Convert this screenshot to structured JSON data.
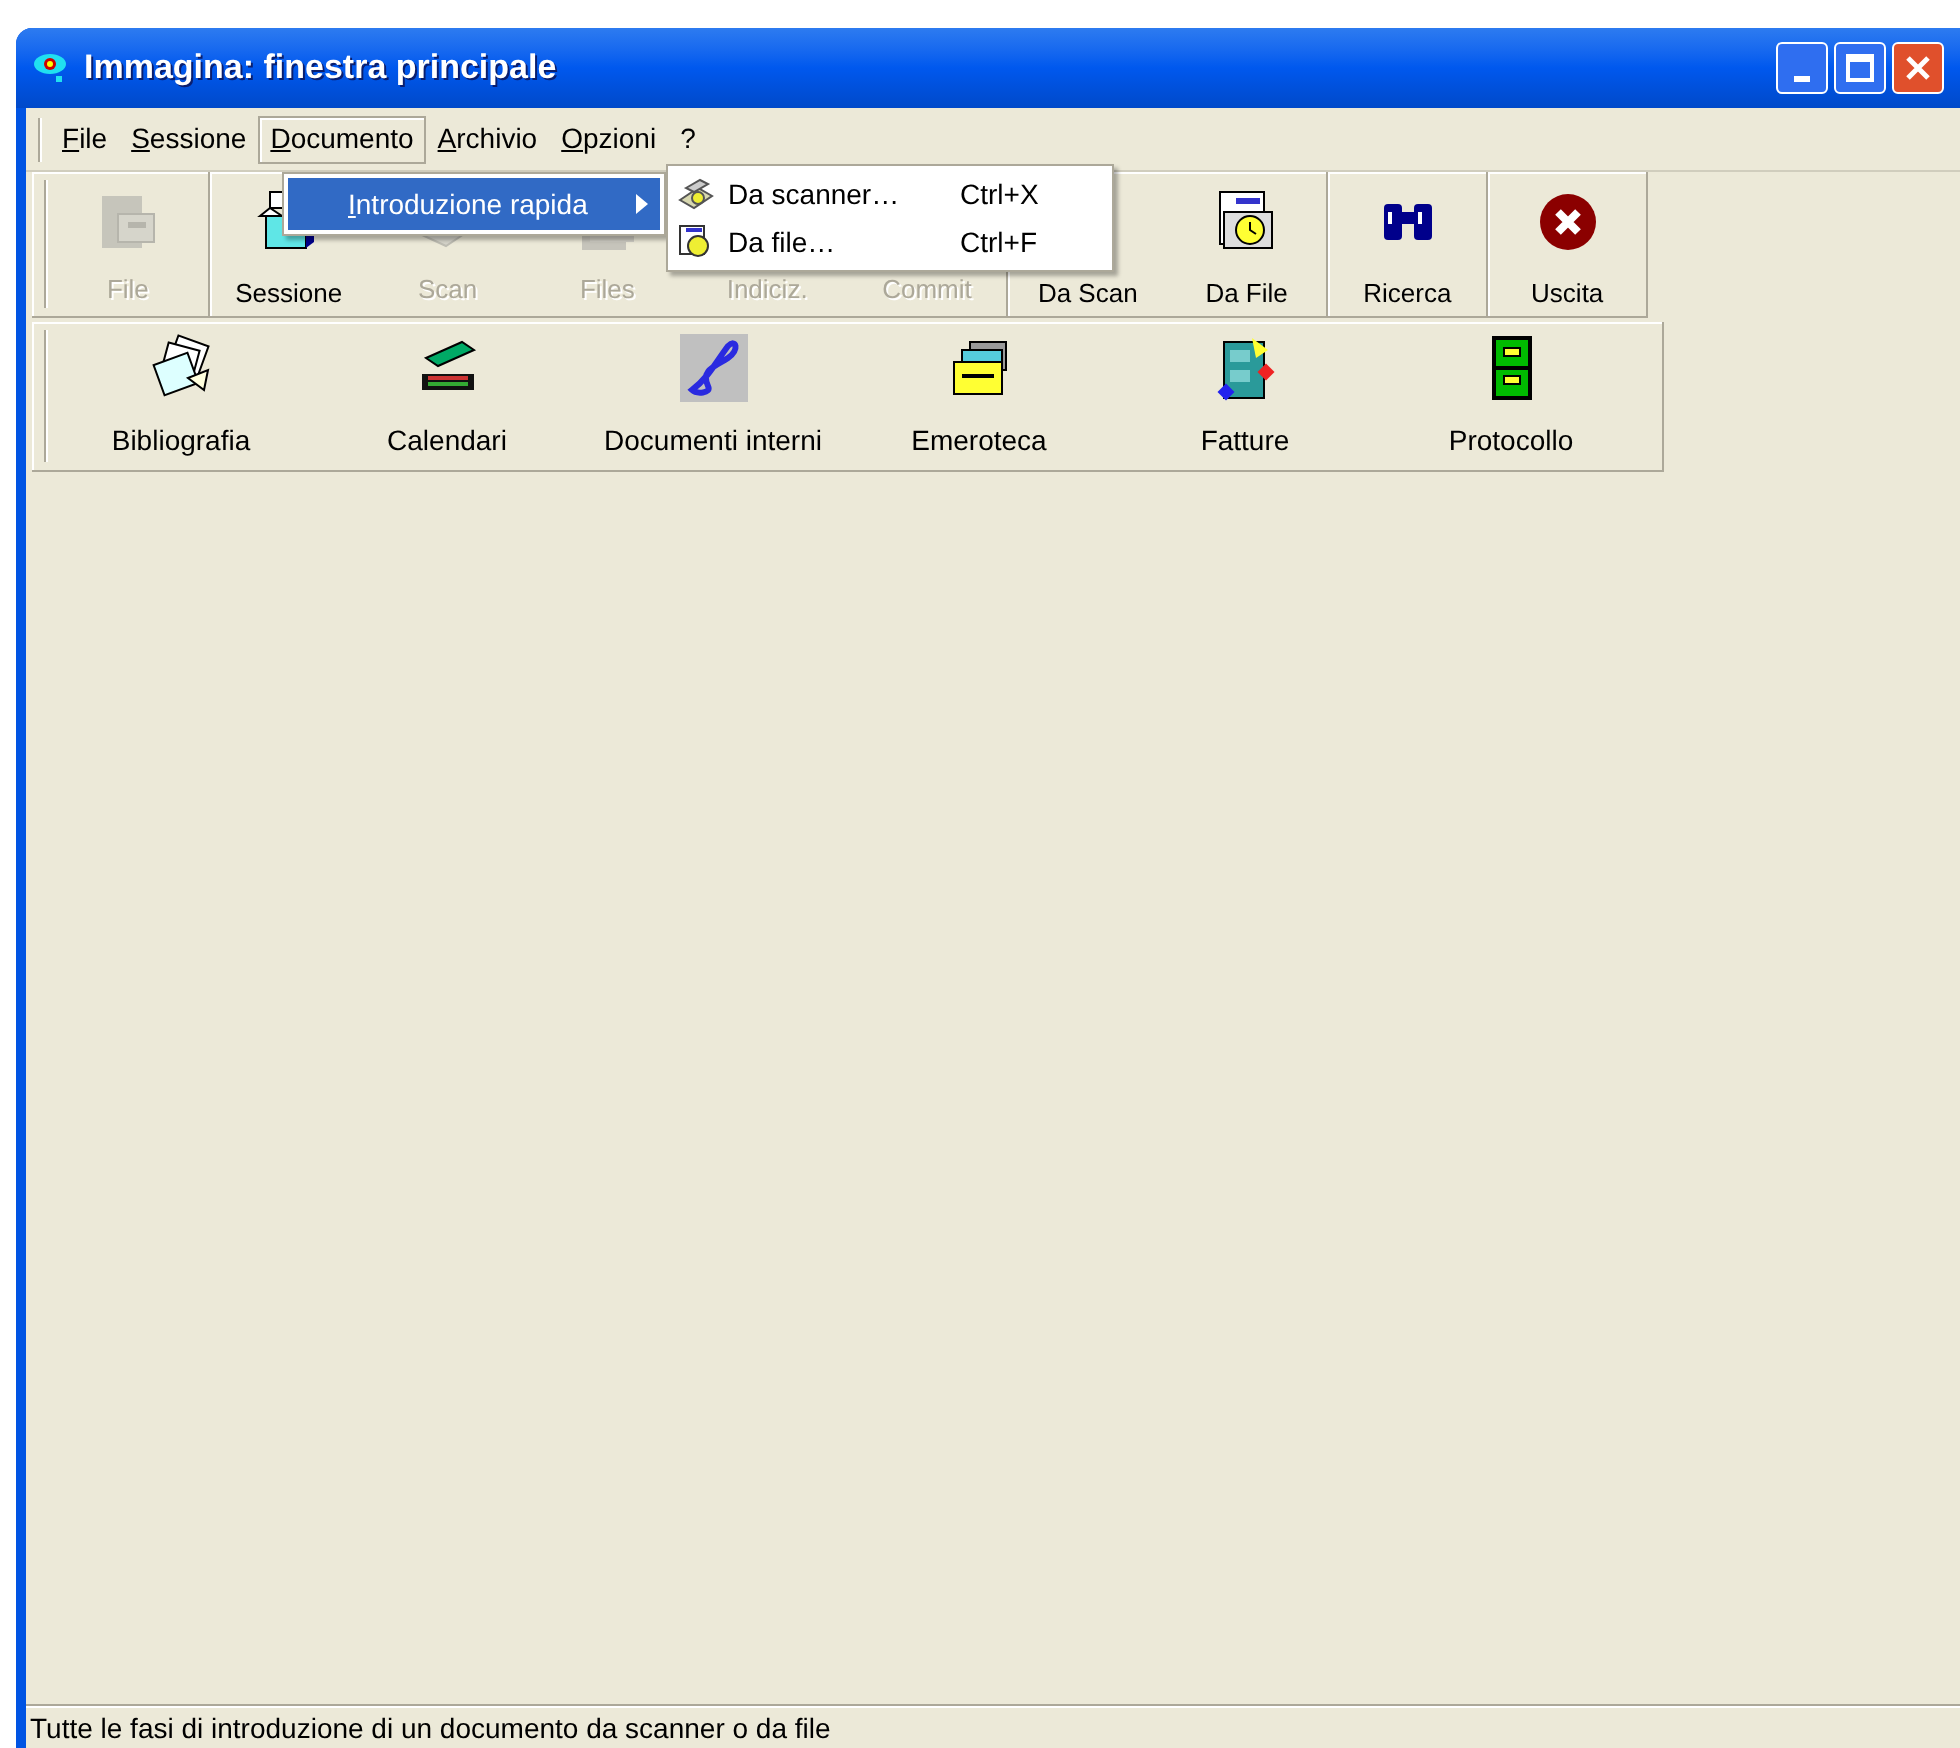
{
  "window": {
    "title": "Immagina: finestra principale"
  },
  "menu_bar": [
    {
      "label": "File",
      "selected": false
    },
    {
      "label": "Sessione",
      "selected": false
    },
    {
      "label": "Documento",
      "selected": true
    },
    {
      "label": "Archivio",
      "selected": false
    },
    {
      "label": "Opzioni",
      "selected": false
    },
    {
      "label": "?",
      "selected": false
    }
  ],
  "menu": {
    "items": [
      {
        "label": "Introduzione rapida",
        "selected": true,
        "submenu": true
      }
    ]
  },
  "submenu": {
    "items": [
      {
        "label": "Da scanner…",
        "shortcut": "Ctrl+X",
        "kind": "scanner"
      },
      {
        "label": "Da file…",
        "shortcut": "Ctrl+F",
        "kind": "file"
      }
    ]
  },
  "toolbar": [
    {
      "label": "File",
      "disabled": true,
      "kind": "file",
      "group_start": true
    },
    {
      "label": "Sessione",
      "disabled": false,
      "kind": "session",
      "group_start": true
    },
    {
      "label": "Scan",
      "disabled": true,
      "kind": "scan",
      "group_start": false
    },
    {
      "label": "Files",
      "disabled": true,
      "kind": "files",
      "group_start": false
    },
    {
      "label": "Indiciz.",
      "disabled": true,
      "kind": "hidden",
      "group_start": false
    },
    {
      "label": "Commit",
      "disabled": true,
      "kind": "hidden",
      "group_start": false
    },
    {
      "label": "Da Scan",
      "disabled": false,
      "kind": "hidden",
      "group_start": true
    },
    {
      "label": "Da File",
      "disabled": false,
      "kind": "fromfile",
      "group_start": false
    },
    {
      "label": "Ricerca",
      "disabled": false,
      "kind": "search",
      "group_start": true
    },
    {
      "label": "Uscita",
      "disabled": false,
      "kind": "exit",
      "group_start": true
    }
  ],
  "archives": [
    {
      "label": "Bibliografia",
      "kind": "cards"
    },
    {
      "label": "Calendari",
      "kind": "scanner"
    },
    {
      "label": "Documenti interni",
      "kind": "signature"
    },
    {
      "label": "Emeroteca",
      "kind": "folders"
    },
    {
      "label": "Fatture",
      "kind": "cabinet"
    },
    {
      "label": "Protocollo",
      "kind": "greencabinet"
    }
  ],
  "status_bar": {
    "text": "Tutte le fasi di introduzione di un documento da scanner o da file"
  }
}
